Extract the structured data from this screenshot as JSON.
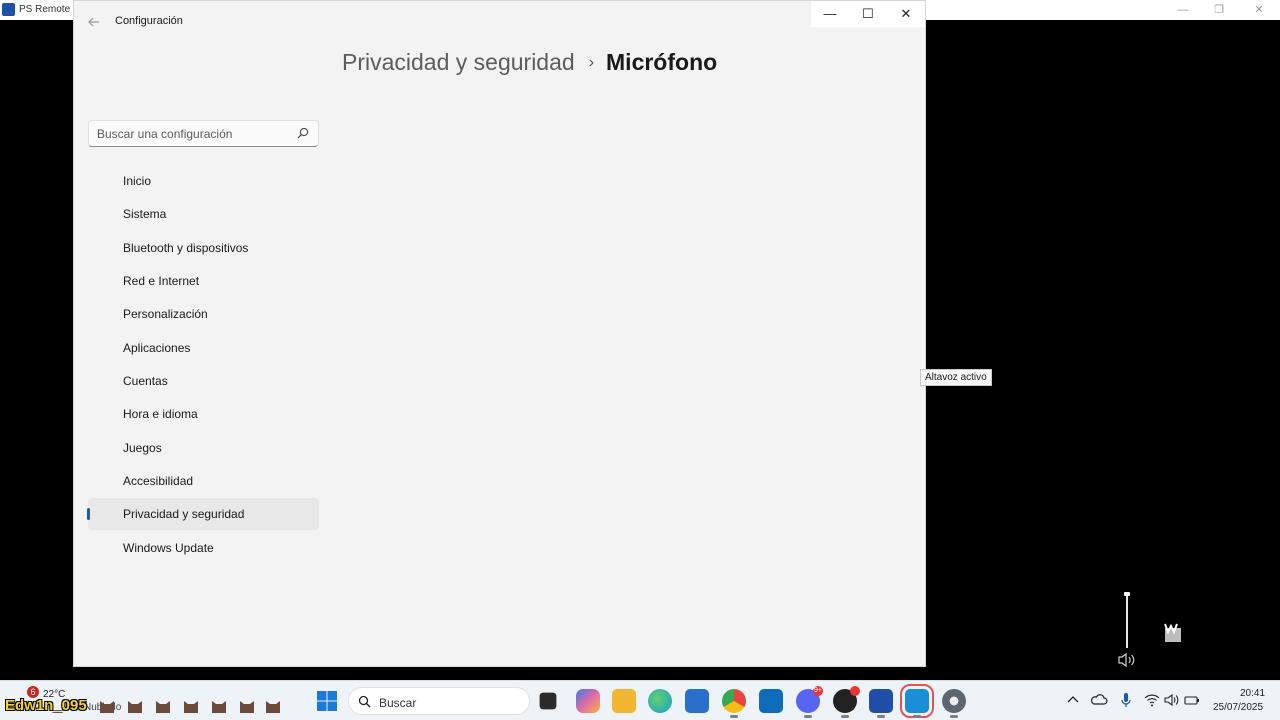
{
  "background_window": {
    "title": "PS Remote Play",
    "controls": {
      "minimize": "—",
      "restore": "❐",
      "close": "✕"
    }
  },
  "window": {
    "title": "Configuración",
    "back_icon": "arrow-left-icon",
    "controls": {
      "minimize": "—",
      "maximize": "☐",
      "close": "✕"
    }
  },
  "breadcrumb": {
    "parent": "Privacidad y seguridad",
    "separator": "›",
    "current": "Micrófono"
  },
  "search": {
    "placeholder": "Buscar una configuración",
    "icon": "search-icon"
  },
  "sidebar": {
    "items": [
      {
        "label": "Inicio",
        "active": false
      },
      {
        "label": "Sistema",
        "active": false
      },
      {
        "label": "Bluetooth y dispositivos",
        "active": false
      },
      {
        "label": "Red e Internet",
        "active": false
      },
      {
        "label": "Personalización",
        "active": false
      },
      {
        "label": "Aplicaciones",
        "active": false
      },
      {
        "label": "Cuentas",
        "active": false
      },
      {
        "label": "Hora e idioma",
        "active": false
      },
      {
        "label": "Juegos",
        "active": false
      },
      {
        "label": "Accesibilidad",
        "active": false
      },
      {
        "label": "Privacidad y seguridad",
        "active": true
      },
      {
        "label": "Windows Update",
        "active": false
      }
    ],
    "accent_color": "#1e5aa8"
  },
  "tooltip": {
    "text": "Altavoz activo"
  },
  "taskbar": {
    "weather": {
      "temperature": "22°C",
      "condition": "Nublado",
      "badge": "6"
    },
    "overlay_name": "Edw1n_095",
    "search_label": "Buscar",
    "apps": [
      {
        "name": "task-view-icon",
        "color": "#2b2b2b"
      },
      {
        "name": "copilot-icon",
        "color": "#e06aa8"
      },
      {
        "name": "file-explorer-icon",
        "color": "#f2b630"
      },
      {
        "name": "edge-icon",
        "color": "#1a9ad6"
      },
      {
        "name": "store-icon",
        "color": "#2a6fc9"
      },
      {
        "name": "chrome-icon",
        "color": "#e8453c"
      },
      {
        "name": "outlook-icon",
        "color": "#0f6cbd"
      },
      {
        "name": "discord-icon",
        "color": "#5865f2"
      },
      {
        "name": "obs-icon",
        "color": "#222222"
      },
      {
        "name": "ps-remote-play-icon",
        "color": "#1f4fa8"
      },
      {
        "name": "ps-app-icon",
        "color": "#1a8fd8"
      },
      {
        "name": "settings-gear-icon",
        "color": "#5e6670"
      }
    ],
    "badges": {
      "discord": "9+"
    },
    "clock": {
      "time": "20:41",
      "date": "25/07/2025"
    }
  }
}
